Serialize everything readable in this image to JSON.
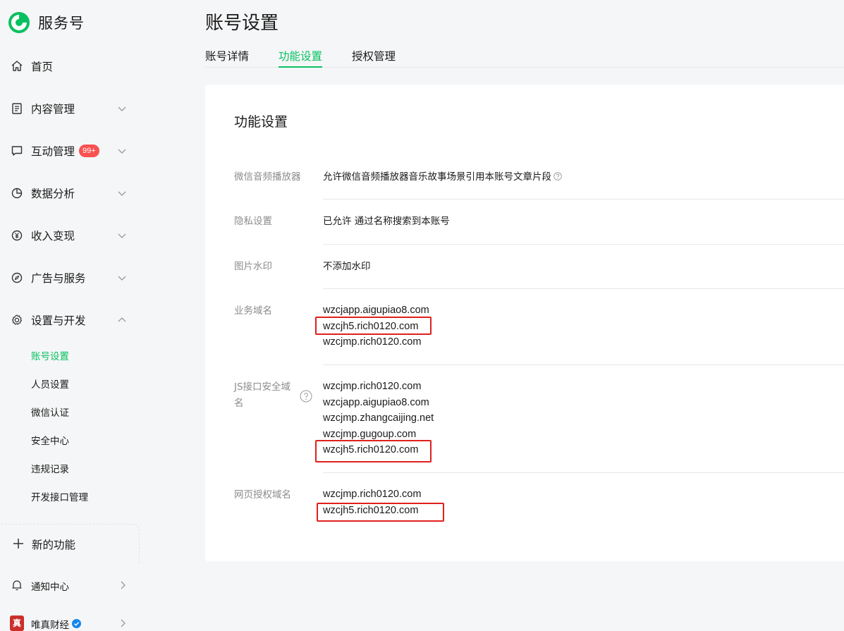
{
  "brand": {
    "name": "服务号"
  },
  "sidebar": {
    "items": [
      {
        "label": "首页",
        "icon": "home-icon"
      },
      {
        "label": "内容管理",
        "icon": "document-icon"
      },
      {
        "label": "互动管理",
        "icon": "chat-icon",
        "badge": "99+"
      },
      {
        "label": "数据分析",
        "icon": "pie-chart-icon"
      },
      {
        "label": "收入变现",
        "icon": "yen-icon"
      },
      {
        "label": "广告与服务",
        "icon": "compass-icon"
      },
      {
        "label": "设置与开发",
        "icon": "gear-icon"
      }
    ],
    "sub_items": [
      {
        "label": "账号设置",
        "active": true
      },
      {
        "label": "人员设置"
      },
      {
        "label": "微信认证"
      },
      {
        "label": "安全中心"
      },
      {
        "label": "违规记录"
      },
      {
        "label": "开发接口管理"
      }
    ],
    "new_features": "新的功能",
    "notice_center": "通知中心",
    "account_name": "唯真财经",
    "account_avatar_char": "真"
  },
  "header": {
    "title": "账号设置",
    "tabs": [
      {
        "label": "账号详情"
      },
      {
        "label": "功能设置",
        "active": true
      },
      {
        "label": "授权管理"
      }
    ]
  },
  "card": {
    "title": "功能设置",
    "rows": [
      {
        "label": "微信音频播放器",
        "value": "允许微信音频播放器音乐故事场景引用本账号文章片段"
      },
      {
        "label": "隐私设置",
        "value": "已允许 通过名称搜索到本账号"
      },
      {
        "label": "图片水印",
        "value": "不添加水印"
      },
      {
        "label": "业务域名",
        "domains": [
          "wzcjapp.aigupiao8.com",
          "wzcjh5.rich0120.com",
          "wzcjmp.rich0120.com"
        ]
      },
      {
        "label_line1": "JS接口安全域",
        "label_line2": "名",
        "domains": [
          "wzcjmp.rich0120.com",
          "wzcjapp.aigupiao8.com",
          "wzcjmp.zhangcaijing.net",
          "wzcjmp.gugoup.com",
          "wzcjh5.rich0120.com"
        ]
      },
      {
        "label": "网页授权域名",
        "domains": [
          "wzcjmp.rich0120.com",
          "wzcjh5.rich0120.com"
        ]
      }
    ]
  },
  "colors": {
    "accent": "#07c160",
    "badge": "#fa5151",
    "highlight": "#e0201c"
  }
}
